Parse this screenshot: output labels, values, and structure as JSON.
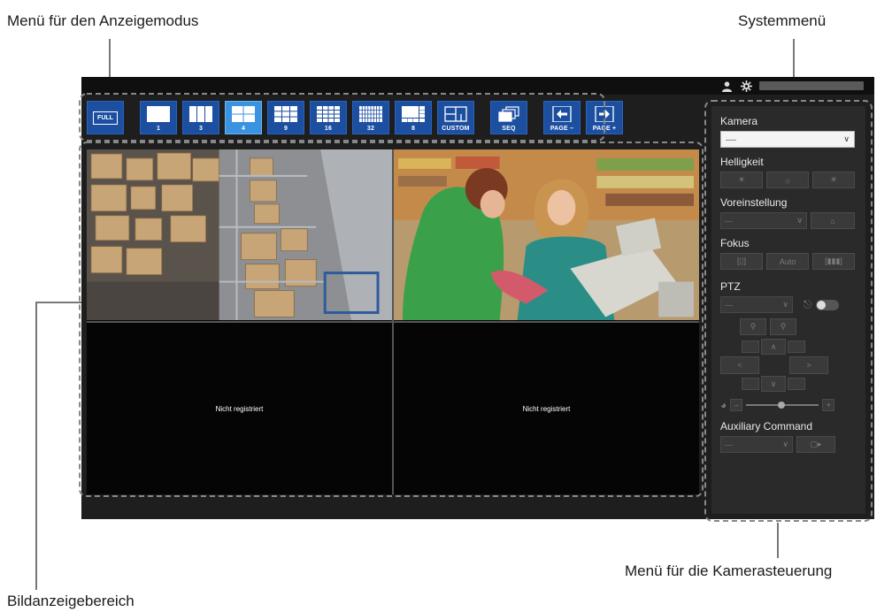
{
  "callouts": {
    "display_mode_menu": "Menü für den Anzeigemodus",
    "system_menu": "Systemmenü",
    "image_display_area": "Bildanzeigebereich",
    "camera_control_menu": "Menü für die Kamerasteuerung"
  },
  "toolbar": {
    "full": "FULL",
    "modes": [
      {
        "label": "1",
        "layout": "1"
      },
      {
        "label": "3",
        "layout": "3"
      },
      {
        "label": "4",
        "layout": "4",
        "active": true
      },
      {
        "label": "9",
        "layout": "9"
      },
      {
        "label": "16",
        "layout": "16"
      },
      {
        "label": "32",
        "layout": "32"
      },
      {
        "label": "8",
        "layout": "8"
      },
      {
        "label": "CUSTOM",
        "layout": "custom"
      }
    ],
    "seq": "SEQ",
    "page_prev": "PAGE –",
    "page_next": "PAGE +"
  },
  "video": {
    "cells": [
      {
        "type": "feed",
        "scene": "warehouse"
      },
      {
        "type": "feed",
        "scene": "supermarket-checkout"
      },
      {
        "type": "empty",
        "text": "Nicht registriert"
      },
      {
        "type": "empty",
        "text": "Nicht registriert"
      }
    ]
  },
  "camera_panel": {
    "camera_label": "Kamera",
    "camera_value": "----",
    "brightness_label": "Helligkeit",
    "preset_label": "Voreinstellung",
    "preset_value": "---",
    "focus_label": "Fokus",
    "focus_auto": "Auto",
    "ptz_label": "PTZ",
    "ptz_value": "---",
    "aux_label": "Auxiliary Command",
    "aux_value": "---"
  },
  "colors": {
    "button_blue": "#1d4fa0",
    "button_active": "#3b92e0",
    "panel_bg": "#2a2a2a",
    "app_bg": "#1e1e1e"
  }
}
